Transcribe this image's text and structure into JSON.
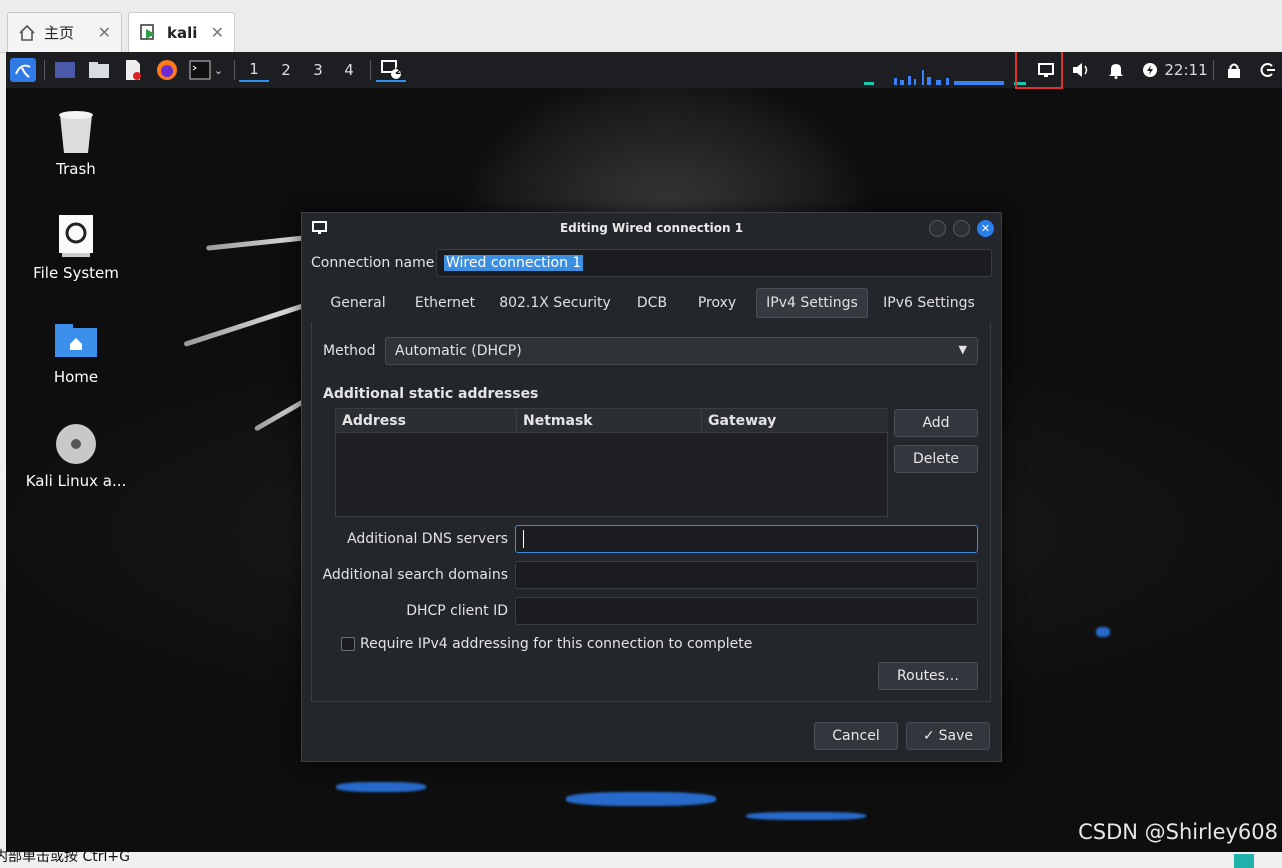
{
  "host": {
    "tabs": [
      {
        "label": "主页",
        "icon": "home-icon"
      },
      {
        "label": "kali",
        "icon": "vm-icon"
      }
    ],
    "status_text": "内部单击或按 Ctrl+G"
  },
  "panel": {
    "workspaces": [
      "1",
      "2",
      "3",
      "4"
    ],
    "active_workspace": "1",
    "window_badge": "2",
    "clock": "22:11"
  },
  "desktop": {
    "icons": [
      {
        "label": "Trash",
        "icon": "trash-icon"
      },
      {
        "label": "File System",
        "icon": "drive-icon"
      },
      {
        "label": "Home",
        "icon": "home-folder-icon"
      },
      {
        "label": "Kali Linux a...",
        "icon": "disc-icon"
      }
    ]
  },
  "dialog": {
    "title": "Editing Wired connection 1",
    "connection_name_label": "Connection name",
    "connection_name_value": "Wired connection 1",
    "tabs": [
      "General",
      "Ethernet",
      "802.1X Security",
      "DCB",
      "Proxy",
      "IPv4 Settings",
      "IPv6 Settings"
    ],
    "active_tab": "IPv4 Settings",
    "method_label": "Method",
    "method_value": "Automatic (DHCP)",
    "static_heading": "Additional static addresses",
    "columns": [
      "Address",
      "Netmask",
      "Gateway"
    ],
    "add_label": "Add",
    "delete_label": "Delete",
    "dns_label": "Additional DNS servers",
    "search_label": "Additional search domains",
    "dhcp_label": "DHCP client ID",
    "require_label": "Require IPv4 addressing for this connection to complete",
    "routes_label": "Routes…",
    "cancel_label": "Cancel",
    "save_label": "Save"
  },
  "watermark": "CSDN @Shirley608",
  "colors": {
    "accent": "#3c8ee0",
    "highlight_box": "#e0312d",
    "dialog_bg": "#23262b"
  }
}
